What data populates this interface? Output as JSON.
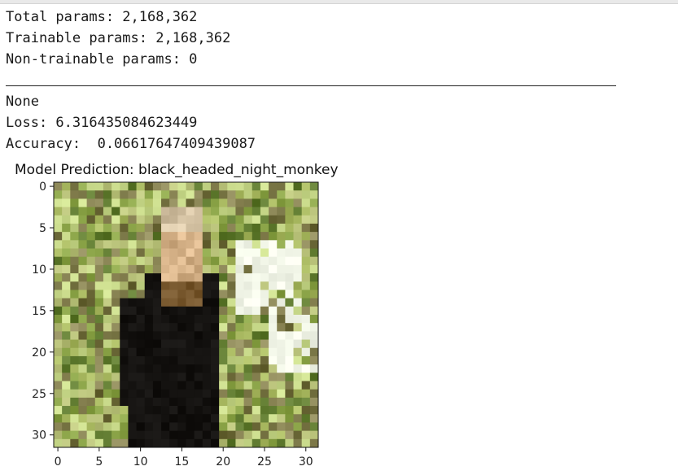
{
  "console": {
    "total_params": "Total params: 2,168,362",
    "trainable_params": "Trainable params: 2,168,362",
    "non_trainable_params": "Non-trainable params: 0",
    "none_output": "None",
    "loss_line": "Loss: 6.316435084623449",
    "accuracy_line": "Accuracy:  0.06617647409439087"
  },
  "plot": {
    "title": "Model Prediction: black_headed_night_monkey",
    "x_ticks": [
      "0",
      "5",
      "10",
      "15",
      "20",
      "25",
      "30"
    ],
    "y_ticks": [
      "0",
      "5",
      "10",
      "15",
      "20",
      "25",
      "30"
    ],
    "image_size": 32,
    "image_content": "32x32 pixelated photo of a monkey among green foliage"
  },
  "colors": {
    "foliage_dark": "#5f7a2f",
    "foliage_mid": "#8aa347",
    "foliage_light": "#c8d98a",
    "monkey_body": "#141210",
    "monkey_face": "#d8b48a",
    "highlight": "#f2f6e8"
  }
}
